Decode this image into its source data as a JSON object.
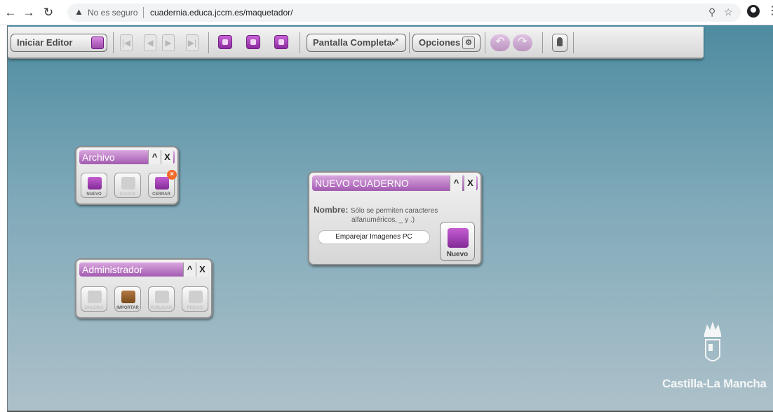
{
  "browser": {
    "security_text": "No es seguro",
    "url": "cuadernia.educa.jccm.es/maquetador/",
    "icons": [
      "back-icon",
      "forward-icon",
      "reload-icon",
      "warning-icon",
      "zoom-icon",
      "star-icon",
      "profile-icon",
      "menu-icon"
    ]
  },
  "toolbar": {
    "start_editor": "Iniciar Editor",
    "fullscreen": "Pantalla Completa",
    "options": "Opciones"
  },
  "panels": {
    "archivo": {
      "title": "Archivo",
      "minimize": "^",
      "close": "X",
      "buttons": [
        {
          "label": "NUEVO",
          "enabled": true
        },
        {
          "label": "ECOFIX",
          "enabled": false
        },
        {
          "label": "CERRAR",
          "enabled": true
        }
      ]
    },
    "administrador": {
      "title": "Administrador",
      "minimize": "^",
      "close": "X",
      "buttons": [
        {
          "label": "GALERIA",
          "enabled": false
        },
        {
          "label": "IMPORTAR",
          "enabled": true
        },
        {
          "label": "PUBLICAR",
          "enabled": false
        },
        {
          "label": "PREVIO",
          "enabled": false
        }
      ]
    },
    "nuevo_cuaderno": {
      "title": "NUEVO CUADERNO",
      "minimize": "^",
      "close": "X",
      "name_label": "Nombre:",
      "hint_line1": "Sólo se permiten caracteres",
      "hint_line2": "alfanuméricos, _ y .)",
      "input_value": "Emparejar Imagenes PC",
      "create_label": "Nuevo"
    }
  },
  "branding": {
    "logo_text": "Castilla-La Mancha"
  },
  "colors": {
    "accent_purple": "#a35bb0",
    "canvas_top": "#4d8ba0",
    "canvas_bottom": "#adc1ca"
  }
}
